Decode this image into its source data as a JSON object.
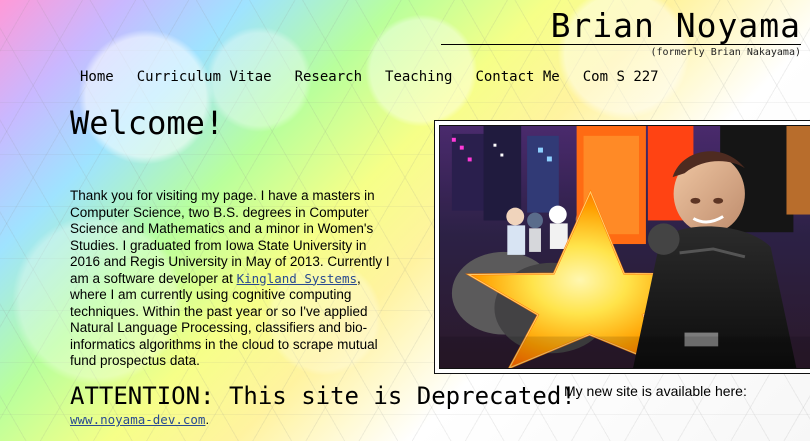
{
  "site": {
    "title": "Brian Noyama",
    "subtitle": "(formerly Brian Nakayama)"
  },
  "nav": {
    "items": [
      {
        "label": "Home"
      },
      {
        "label": "Curriculum Vitae"
      },
      {
        "label": "Research"
      },
      {
        "label": "Teaching"
      },
      {
        "label": "Contact Me"
      },
      {
        "label": "Com S 227"
      }
    ]
  },
  "main": {
    "heading": "Welcome!",
    "intro_before_link": "Thank you for visiting my page. I have a masters in Computer Science, two B.S. degrees in Computer Science and Mathematics and a minor in Women's Studies. I graduated from Iowa State University in 2016 and Regis University in May of 2013. Currently I am a software developer at ",
    "company_link": "Kingland Systems",
    "intro_after_link": ", where I am currently using cognitive computing techniques. Within the past year or so I've applied Natural Language Processing, classifiers and bio-informatics algorithms in the cloud to scrape mutual fund prospectus data.",
    "attention": "ATTENTION: This site is Deprecated!",
    "new_site_note": "My new site is available here:",
    "new_site_link": "www.noyama-dev.com",
    "new_site_suffix": "."
  },
  "colors": {
    "link": "#2a4b91",
    "text": "#000000",
    "frame": "#111111"
  },
  "icons": {
    "photo": "photo-portrait"
  }
}
